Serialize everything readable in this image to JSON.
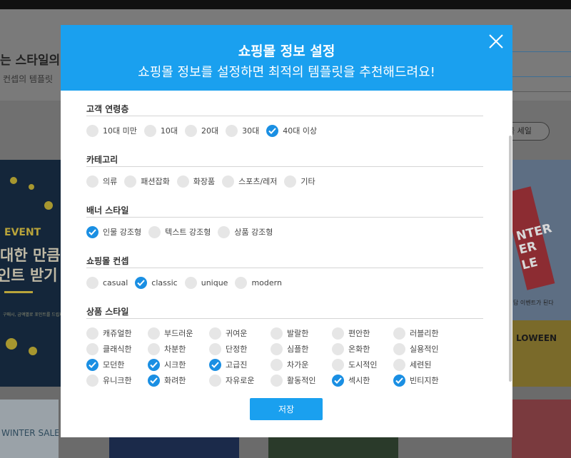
{
  "background": {
    "heading": "는 스타일의",
    "subheading": "컨셉의 템플릿",
    "filter_pill": "물 세일",
    "event_card": {
      "event": "EVENT",
      "line1": "대한 만큼",
      "line2": "인트 받기",
      "tiny": "구매시, 금액별로 포인트를 드립니다"
    },
    "winter_card": {
      "line1": "NTER",
      "line2": "ER",
      "line3": "LE",
      "caption": "답 이벤트가 된다"
    },
    "halloween_card": {
      "text": "LOWEEN"
    },
    "winter_sale": "WINTER SALE"
  },
  "modal": {
    "title": "쇼핑몰 정보 설정",
    "subtitle": "쇼핑몰 정보를 설정하면 최적의 템플릿을 추천해드려요!",
    "save_label": "저장",
    "sections": [
      {
        "title": "고객 연령층",
        "options": [
          {
            "label": "10대 미만",
            "checked": false
          },
          {
            "label": "10대",
            "checked": false
          },
          {
            "label": "20대",
            "checked": false
          },
          {
            "label": "30대",
            "checked": false
          },
          {
            "label": "40대 이상",
            "checked": true
          }
        ]
      },
      {
        "title": "카테고리",
        "options": [
          {
            "label": "의류",
            "checked": false
          },
          {
            "label": "패션잡화",
            "checked": false
          },
          {
            "label": "화장품",
            "checked": false
          },
          {
            "label": "스포츠/레저",
            "checked": false
          },
          {
            "label": "기타",
            "checked": false
          }
        ]
      },
      {
        "title": "배너 스타일",
        "options": [
          {
            "label": "인물 강조형",
            "checked": true
          },
          {
            "label": "텍스트 강조형",
            "checked": false
          },
          {
            "label": "상품 강조형",
            "checked": false
          }
        ]
      },
      {
        "title": "쇼핑몰 컨셉",
        "options": [
          {
            "label": "casual",
            "checked": false
          },
          {
            "label": "classic",
            "checked": true
          },
          {
            "label": "unique",
            "checked": false
          },
          {
            "label": "modern",
            "checked": false
          }
        ]
      },
      {
        "title": "상품 스타일",
        "options": [
          {
            "label": "캐쥬얼한",
            "checked": false
          },
          {
            "label": "부드러운",
            "checked": false
          },
          {
            "label": "귀여운",
            "checked": false
          },
          {
            "label": "발랄한",
            "checked": false
          },
          {
            "label": "편안한",
            "checked": false
          },
          {
            "label": "러블리한",
            "checked": false
          },
          {
            "label": "클래식한",
            "checked": false
          },
          {
            "label": "차분한",
            "checked": false
          },
          {
            "label": "단정한",
            "checked": false
          },
          {
            "label": "심플한",
            "checked": false
          },
          {
            "label": "온화한",
            "checked": false
          },
          {
            "label": "실용적인",
            "checked": false
          },
          {
            "label": "모던한",
            "checked": true
          },
          {
            "label": "시크한",
            "checked": true
          },
          {
            "label": "고급진",
            "checked": true
          },
          {
            "label": "차가운",
            "checked": false
          },
          {
            "label": "도시적인",
            "checked": false
          },
          {
            "label": "세련된",
            "checked": false
          },
          {
            "label": "유니크한",
            "checked": false
          },
          {
            "label": "화려한",
            "checked": true
          },
          {
            "label": "자유로운",
            "checked": false
          },
          {
            "label": "활동적인",
            "checked": false
          },
          {
            "label": "섹시한",
            "checked": true
          },
          {
            "label": "빈티지한",
            "checked": true
          }
        ]
      }
    ]
  },
  "colors": {
    "accent": "#1aa0ef",
    "check": "#1a8fe3",
    "unchecked": "#e6e6e6"
  },
  "icons": {
    "close": "close-icon",
    "check": "check-icon"
  }
}
